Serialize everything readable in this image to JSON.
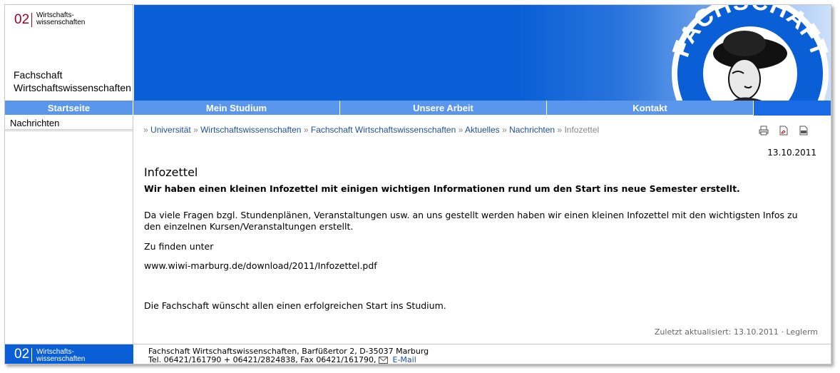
{
  "header": {
    "logo_number": "02",
    "logo_sub_line1": "Wirtschafts-",
    "logo_sub_line2": "wissenschaften",
    "site_title_line1": "Fachschaft",
    "site_title_line2": "Wirtschaftswissenschaften",
    "seal_text": "FACHSCHAFT"
  },
  "nav": {
    "items": [
      {
        "label": "Startseite"
      },
      {
        "label": "Mein Studium"
      },
      {
        "label": "Unsere Arbeit"
      },
      {
        "label": "Kontakt"
      }
    ]
  },
  "sidebar": {
    "items": [
      {
        "label": "Nachrichten"
      }
    ]
  },
  "breadcrumb": {
    "marker": "»",
    "items": [
      "Universität",
      "Wirtschaftswissenschaften",
      "Fachschaft Wirtschaftswissenschaften",
      "Aktuelles",
      "Nachrichten"
    ],
    "current": "Infozettel"
  },
  "tools": [
    "print-icon",
    "pdf-icon",
    "url-icon"
  ],
  "article": {
    "date": "13.10.2011",
    "title": "Infozettel",
    "lead": "Wir haben einen kleinen Infozettel mit einigen wichtigen Informationen rund um den Start ins neue Semester erstellt.",
    "paragraph1": "Da viele Fragen bzgl. Stundenplänen, Veranstaltungen usw. an uns gestellt werden haben wir einen kleinen Infozettel mit den wichtigsten Infos zu den einzelnen Kursen/Veranstaltungen erstellt.",
    "paragraph2": "Zu finden unter",
    "paragraph3": "www.wiwi-marburg.de/download/2011/Infozettel.pdf",
    "paragraph4": "Die Fachschaft wünscht allen einen erfolgreichen Start ins Studium."
  },
  "meta": {
    "updated_label": "Zuletzt aktualisiert: 13.10.2011",
    "separator": "·",
    "author": "Leglerm"
  },
  "footer": {
    "logo_number": "02",
    "logo_sub_line1": "Wirtschafts-",
    "logo_sub_line2": "wissenschaften",
    "address": "Fachschaft Wirtschaftswissenschaften, Barfüßertor 2, D-35037 Marburg",
    "phone": "Tel. 06421/161790 + 06421/2824838, Fax 06421/161790,",
    "email_label": "E-Mail"
  },
  "colors": {
    "brand_blue": "#0a5fd6",
    "nav_blue": "#5a96ec",
    "logo_red": "#a3002a",
    "link_blue": "#1f4f9a"
  }
}
